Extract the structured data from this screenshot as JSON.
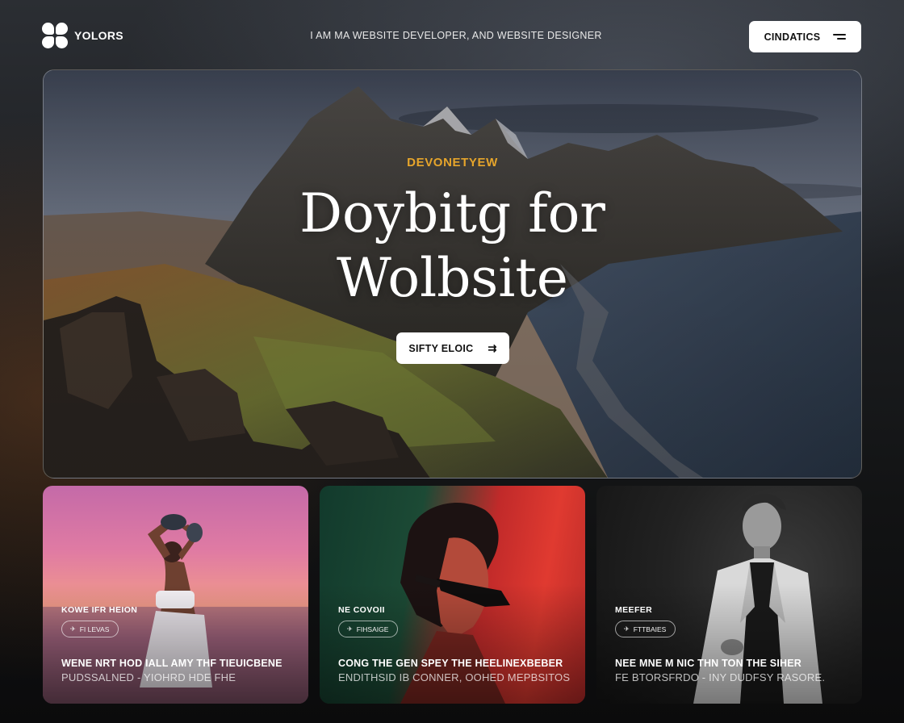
{
  "header": {
    "logo_text": "YOLORS",
    "tagline": "I AM MA WEBSITE DEVELOPER, AND WEBSITE DESIGNER",
    "button_label": "CINDATICS",
    "button_icon": "menu-icon"
  },
  "hero": {
    "eyebrow": "DEVONETYEW",
    "title_line1": "Doybitg for",
    "title_line2": "Wolbsite",
    "button_label": "SIFTY ELOIC",
    "button_icon": "arrow-icon",
    "eyebrow_color": "#e6a52b"
  },
  "cards": [
    {
      "category": "KOWE IFR HEION",
      "tag": "FI LEVAS",
      "title": "WENE NRT HOD IALL AMY THF TIEUICBENE",
      "subtitle": "PUDSSALNED - YIOHRD HDE FHE"
    },
    {
      "category": "NE COVOII",
      "tag": "FIHSAIGE",
      "title": "CONG THE GEN SPEY THE HEELINEXBEBER",
      "subtitle": "ENDITHSID IB CONNER, OOHED MEPBSITOS"
    },
    {
      "category": "MEEFER",
      "tag": "FTTBAIES",
      "title": "NEE MNE M NIC THN TON THE SIHER",
      "subtitle": "FE BTORSFRDO - INY DUDFSY RASORE."
    }
  ]
}
